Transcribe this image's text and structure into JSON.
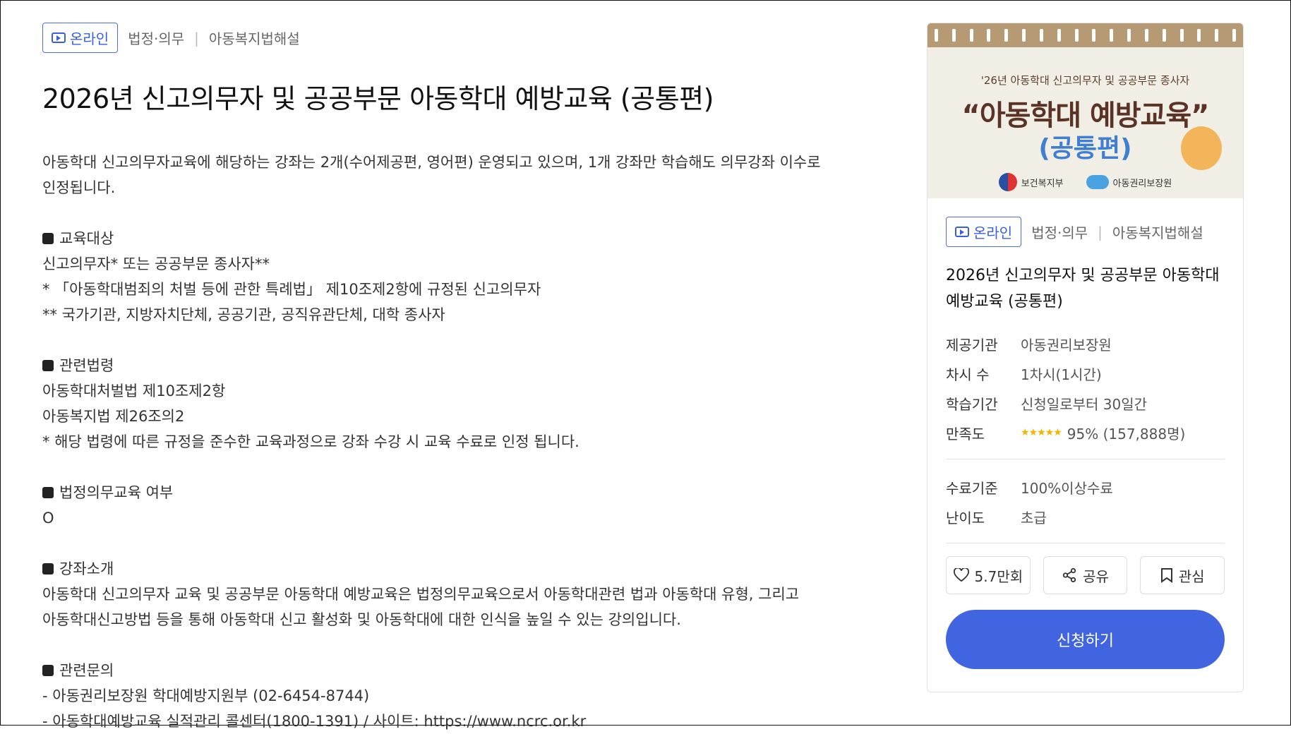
{
  "meta": {
    "badge": "온라인",
    "category": "법정·의무",
    "subcategory": "아동복지법해설"
  },
  "title": "2026년 신고의무자 및 공공부문 아동학대 예방교육 (공통편)",
  "intro": [
    "아동학대 신고의무자교육에 해당하는 강좌는 2개(수어제공편, 영어편) 운영되고 있으며, 1개 강좌만 학습해도 의무강좌 이수로",
    "인정됩니다."
  ],
  "sections": [
    {
      "head": "교육대상",
      "lines": [
        "신고의무자* 또는 공공부문 종사자**",
        "* 「아동학대범죄의 처벌 등에 관한 특례법」 제10조제2항에 규정된 신고의무자",
        "** 국가기관, 지방자치단체, 공공기관, 공직유관단체, 대학 종사자"
      ]
    },
    {
      "head": "관련법령",
      "lines": [
        "아동학대처벌법 제10조제2항",
        "아동복지법 제26조의2",
        "* 해당 법령에 따른 규정을 준수한 교육과정으로 강좌 수강 시 교육 수료로 인정 됩니다."
      ]
    },
    {
      "head": "법정의무교육 여부",
      "lines": [
        "O"
      ]
    },
    {
      "head": "강좌소개",
      "lines": [
        "아동학대 신고의무자 교육 및 공공부문 아동학대 예방교육은 법정의무교육으로서 아동학대관련 법과 아동학대 유형, 그리고",
        "아동학대신고방법 등을 통해 아동학대 신고 활성화 및 아동학대에 대한 인식을 높일 수 있는 강의입니다."
      ]
    },
    {
      "head": "관련문의",
      "lines": [
        "- 아동권리보장원 학대예방지원부 (02-6454-8744)",
        "- 아동학대예방교육 실적관리 콜센터(1800-1391) / 사이트: https://www.ncrc.or.kr"
      ]
    }
  ],
  "banner": {
    "sub": "'26년 아동학대 신고의무자 및 공공부문 종사자",
    "main": "“아동학대 예방교육”",
    "main2": "(공통편)",
    "logo1": "보건복지부",
    "logo2": "아동권리보장원"
  },
  "side": {
    "title": "2026년 신고의무자 및 공공부문 아동학대 예방교육 (공통편)",
    "info": [
      {
        "k": "제공기관",
        "v": "아동권리보장원"
      },
      {
        "k": "차시 수",
        "v": "1차시(1시간)"
      },
      {
        "k": "학습기간",
        "v": "신청일로부터 30일간"
      }
    ],
    "rating": {
      "k": "만족도",
      "stars": "★★★★★",
      "v": "95% (157,888명)"
    },
    "info2": [
      {
        "k": "수료기준",
        "v": "100%이상수료"
      },
      {
        "k": "난이도",
        "v": "초급"
      }
    ],
    "like_label": "5.7만회",
    "share_label": "공유",
    "bookmark_label": "관심",
    "apply_label": "신청하기"
  }
}
